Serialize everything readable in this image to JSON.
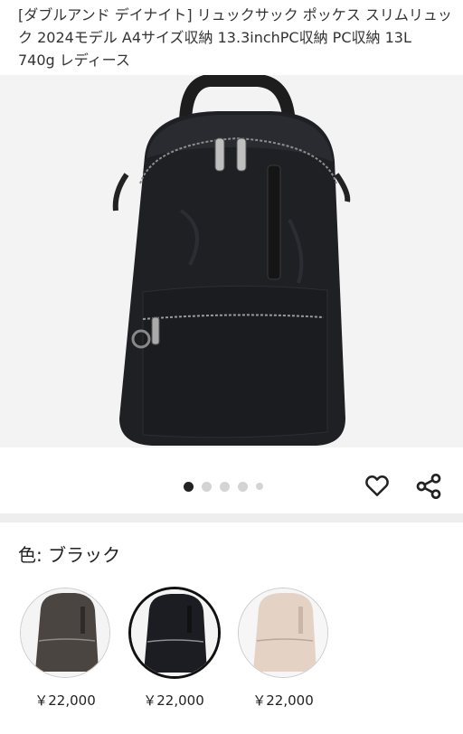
{
  "product": {
    "title": "[ダブルアンド デイナイト] リュックサック ポッケス スリムリュック 2024モデル A4サイズ収納 13.3inchPC収納 PC収納 13L 740g レディース"
  },
  "gallery": {
    "dot_count": 5,
    "active_index": 0
  },
  "actions": {
    "favorite_icon": "heart-outline-icon",
    "share_icon": "share-icon"
  },
  "color_selector": {
    "label": "色: ブラック",
    "options": [
      {
        "name": "brown",
        "color": "#4a4540",
        "price": "￥22,000"
      },
      {
        "name": "black",
        "color": "#1c1d22",
        "price": "￥22,000",
        "selected": true
      },
      {
        "name": "beige",
        "color": "#e4d3c5",
        "price": "￥22,000"
      }
    ]
  }
}
